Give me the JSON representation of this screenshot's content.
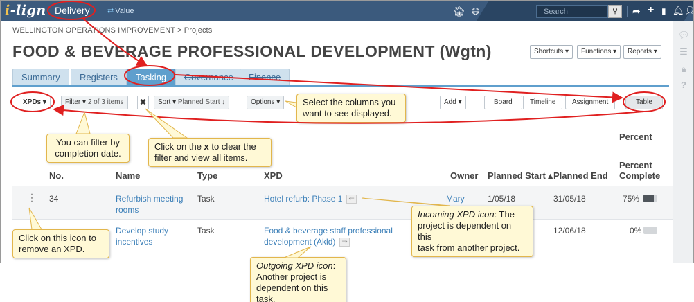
{
  "brand": {
    "logo_i": "i",
    "logo_rest": "-lign"
  },
  "nav": {
    "delivery": "Delivery",
    "value_icon": "⇄",
    "value": "Value"
  },
  "topbar": {
    "search_placeholder": "Search"
  },
  "breadcrumb": "WELLINGTON OPERATIONS IMPROVEMENT > Projects",
  "page_title": "FOOD & BEVERAGE PROFESSIONAL DEVELOPMENT (Wgtn)",
  "header_buttons": {
    "shortcuts": "Shortcuts ▾",
    "functions": "Functions ▾",
    "reports": "Reports ▾"
  },
  "tabs": [
    {
      "label": "Summary"
    },
    {
      "label": "Registers"
    },
    {
      "label": "Tasking"
    },
    {
      "label": "Governance"
    },
    {
      "label": "Finance"
    }
  ],
  "toolbar": {
    "xpds": "XPDs ▾",
    "filter": "Filter ▾",
    "filter_count": "2 of 3 items",
    "clear": "✖",
    "sort": "Sort ▾",
    "sort_field": "Planned Start ↓",
    "options": "Options ▾",
    "add": "Add ▾",
    "board": "Board",
    "timeline": "Timeline",
    "assignment": "Assignment",
    "table": "Table"
  },
  "table": {
    "percent_group": "Percent",
    "headers": {
      "no": "No.",
      "name": "Name",
      "type": "Type",
      "xpd": "XPD",
      "owner": "Owner",
      "planned_start": "Planned Start ▴",
      "planned_end": "Planned End",
      "percent_complete_1": "Percent",
      "percent_complete_2": "Complete"
    },
    "rows": [
      {
        "no": "34",
        "name_1": "Refurbish meeting",
        "name_2": "rooms",
        "type": "Task",
        "xpd": "Hotel refurb: Phase 1",
        "xpd_icon": "⇐",
        "owner": "Mary",
        "planned_start": "1/05/18",
        "planned_end": "31/05/18",
        "percent": "75%",
        "percent_value": 75
      },
      {
        "no": "",
        "name_1": "Develop study",
        "name_2": "incentives",
        "type": "Task",
        "xpd_1": "Food & beverage staff professional",
        "xpd_2": "development (Akld)",
        "xpd_icon": "⇒",
        "owner": "",
        "planned_start": "",
        "planned_end": "12/06/18",
        "percent": "0%",
        "percent_value": 0
      }
    ]
  },
  "callouts": {
    "columns_1": "Select the columns you",
    "columns_2": "want to see displayed.",
    "filter_1": "You can filter by",
    "filter_2": "completion date.",
    "clear_pre": "Click on the ",
    "clear_x": "x",
    "clear_post": " to clear the",
    "clear_2": "filter and view all items.",
    "incoming_em": "Incoming XPD icon",
    "incoming_1": ": The",
    "incoming_2": "project is dependent on this",
    "incoming_3": "task from another project.",
    "remove_1": "Click on this icon to",
    "remove_2": "remove an XPD.",
    "outgoing_em": "Outgoing XPD icon",
    "outgoing_1": ":",
    "outgoing_2": "Another project is",
    "outgoing_3": "dependent on this task."
  },
  "colors": {
    "topbar": "#3b5a7d",
    "accent": "#5f9fcd",
    "annotation": "#e02020",
    "callout_bg": "#fff9d6"
  }
}
